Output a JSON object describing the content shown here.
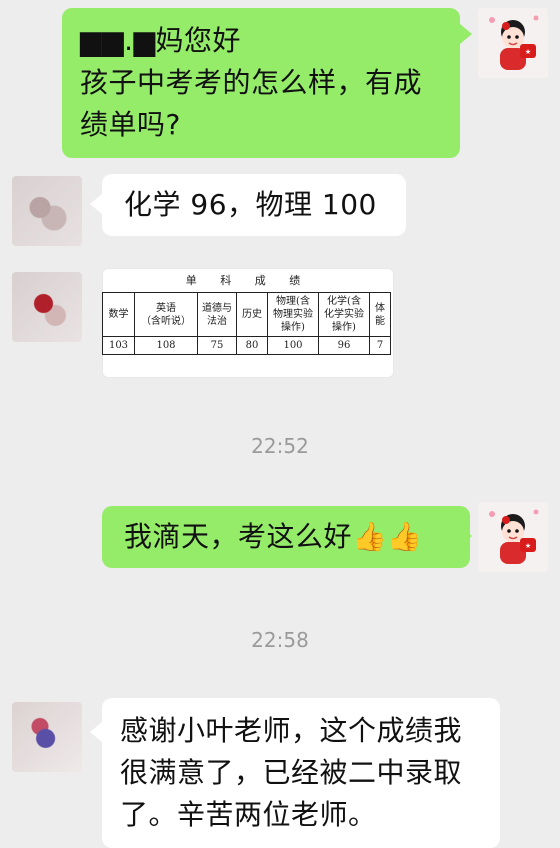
{
  "chat": {
    "messages": [
      {
        "side": "right",
        "lines": [
          "▆▆.▆妈您好",
          "孩子中考考的怎么样，有成",
          "绩单吗?"
        ]
      },
      {
        "side": "left",
        "text": "化学 96，物理 100"
      },
      {
        "side": "left",
        "type": "image"
      },
      {
        "side": "right",
        "text": "我滴天，考这么好👍👍"
      },
      {
        "side": "left",
        "lines": [
          "感谢小叶老师，这个成绩我",
          "很满意了，已经被二中录取",
          "了。辛苦两位老师。"
        ]
      }
    ],
    "timestamps": [
      "22:52",
      "22:58"
    ]
  },
  "score_card": {
    "title": "单 科 成 绩",
    "headers": [
      "数学",
      "英语\n（含听说）",
      "道德与\n法治",
      "历史",
      "物理(含\n物理实验\n操作)",
      "化学(含\n化学实验\n操作)",
      "体\n能"
    ],
    "values": [
      "103",
      "108",
      "75",
      "80",
      "100",
      "96",
      "7"
    ]
  },
  "colors": {
    "background": "#ededed",
    "green_bubble": "#95ec69",
    "white_bubble": "#ffffff",
    "timestamp": "#9a9a9a"
  }
}
